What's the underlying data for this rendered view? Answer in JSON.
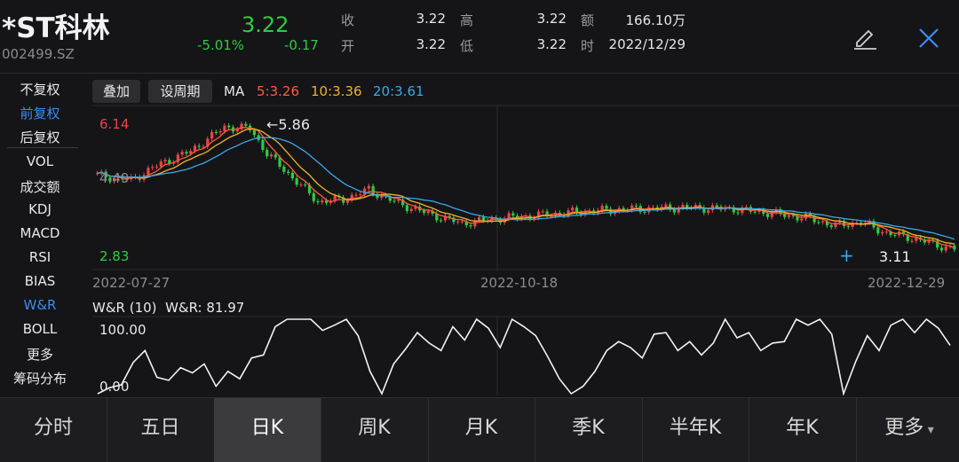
{
  "header": {
    "stock_name": "*ST科林",
    "stock_code": "002499.SZ",
    "price": "3.22",
    "change_pct": "-5.01%",
    "change_amt": "-0.17",
    "quote": {
      "close_label": "收",
      "close": "3.22",
      "high_label": "高",
      "high": "3.22",
      "amount_label": "额",
      "amount": "166.10万",
      "open_label": "开",
      "open": "3.22",
      "low_label": "低",
      "low": "3.22",
      "time_label": "时",
      "time": "2022/12/29"
    },
    "icons": {
      "edit": "pencil-icon",
      "close": "close-icon"
    }
  },
  "left_menu": {
    "items": [
      "不复权",
      "前复权",
      "后复权",
      "VOL",
      "成交额",
      "KDJ",
      "MACD",
      "RSI",
      "BIAS",
      "W&R",
      "BOLL",
      "更多",
      "筹码分布"
    ],
    "active": [
      "前复权",
      "W&R"
    ]
  },
  "toolbar": {
    "overlay": "叠加",
    "set_period": "设周期",
    "ma_label": "MA",
    "ma5": "5:3.26",
    "ma10": "10:3.36",
    "ma20": "20:3.61",
    "colors": {
      "ma5": "#ff5a3c",
      "ma10": "#f0b12c",
      "ma20": "#3aa8e8"
    }
  },
  "kline": {
    "top_price": "6.14",
    "bottom_price": "2.83",
    "left_mid_label": "4.49",
    "peak_label": "5.86",
    "last_label": "3.11",
    "dates": [
      "2022-07-27",
      "2022-10-18",
      "2022-12-29"
    ],
    "colors": {
      "up": "#e84545",
      "down": "#2ecc40"
    }
  },
  "chart_data": {
    "type": "line",
    "title": "",
    "series": [
      {
        "name": "W&R (10)",
        "values": [
          0,
          8,
          12,
          42,
          58,
          22,
          18,
          35,
          28,
          40,
          10,
          30,
          20,
          48,
          52,
          90,
          100,
          100,
          100,
          85,
          92,
          100,
          78,
          30,
          0,
          40,
          60,
          82,
          68,
          58,
          90,
          72,
          100,
          88,
          62,
          100,
          90,
          78,
          50,
          20,
          0,
          10,
          30,
          58,
          70,
          62,
          48,
          80,
          82,
          58,
          70,
          52,
          68,
          100,
          75,
          82,
          58,
          68,
          70,
          100,
          92,
          100,
          80,
          0,
          42,
          78,
          58,
          92,
          100,
          82,
          100,
          88,
          65
        ]
      }
    ],
    "ylim": [
      0,
      100
    ],
    "y_labels": [
      "100.00",
      "0.00"
    ],
    "current_label": "W&R (10)",
    "current_value_text": "W&R: 81.97"
  },
  "bottom_tabs": {
    "items": [
      "分时",
      "五日",
      "日K",
      "周K",
      "月K",
      "季K",
      "半年K",
      "年K",
      "更多"
    ],
    "active": "日K"
  }
}
